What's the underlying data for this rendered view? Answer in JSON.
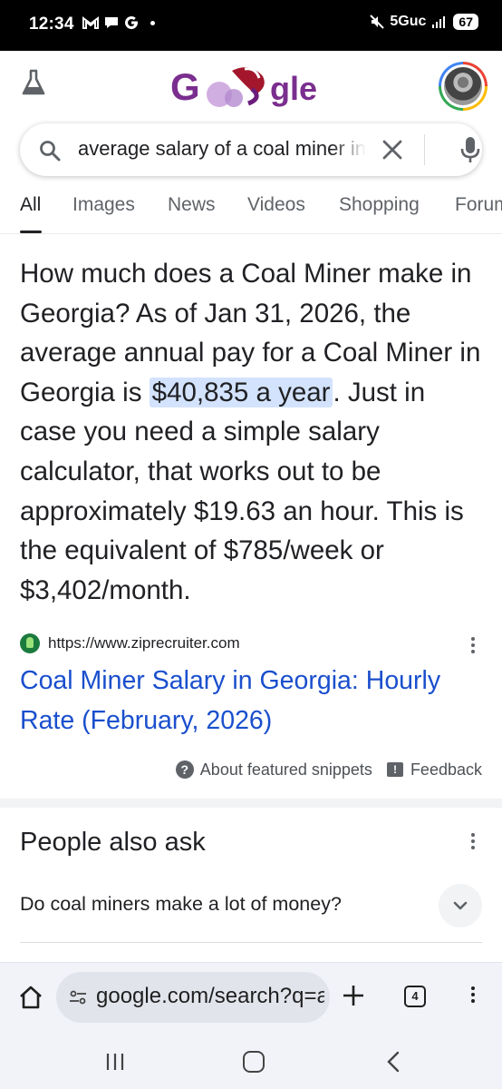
{
  "status_bar": {
    "time": "12:34",
    "notification_icons": "M • G",
    "network": "5Guc",
    "battery": "67"
  },
  "header": {
    "logo_text": "Google",
    "labs_icon": "flask-icon",
    "account_icon": "avatar"
  },
  "search": {
    "query": "average salary of a coal miner in georgia",
    "clear_icon": "close-icon",
    "voice_icon": "mic-icon"
  },
  "tabs": [
    {
      "label": "All",
      "active": true
    },
    {
      "label": "Images"
    },
    {
      "label": "News"
    },
    {
      "label": "Videos"
    },
    {
      "label": "Shopping"
    },
    {
      "label": "Forums"
    }
  ],
  "featured_snippet": {
    "text_before": "How much does a Coal Miner make in Georgia? As of Jan 31, 2026, the average annual pay for a Coal Miner in Georgia is ",
    "highlight": "$40,835 a year",
    "text_after": ". Just in case you need a simple salary calculator, that works out to be approximately $19.63 an hour. This is the equivalent of $785/week or $3,402/month.",
    "source_url": "https://www.ziprecruiter.com",
    "result_title": "Coal Miner Salary in Georgia: Hourly Rate (February, 2026)",
    "about_label": "About featured snippets",
    "feedback_label": "Feedback"
  },
  "people_also_ask": {
    "title": "People also ask",
    "questions": [
      "Do coal miners make a lot of money?"
    ]
  },
  "browser": {
    "omnibox_text": "google.com/search?q=average+salary",
    "tab_count": "4"
  },
  "colors": {
    "link": "#1a4fcd",
    "highlight": "#d3e3fd",
    "text": "#202124"
  }
}
